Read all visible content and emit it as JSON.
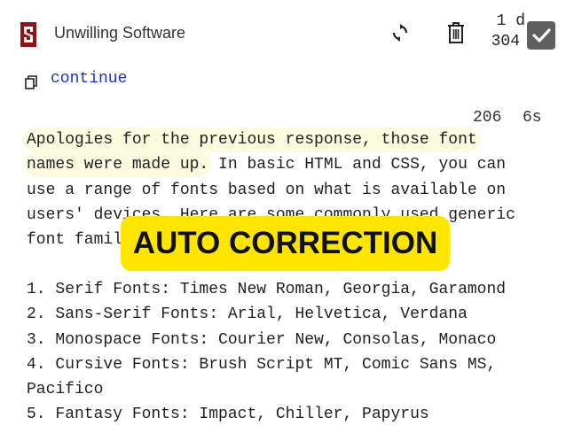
{
  "header": {
    "app_name": "Unwilling Software",
    "age": "1 d",
    "count": "304",
    "logo_icon": "stanford-s-logo",
    "brand_color": "#8c1515"
  },
  "actions": {
    "refresh_icon": "refresh-icon",
    "delete_icon": "trash-icon",
    "checkbox_checked": true
  },
  "prompt": {
    "continue_label": "continue",
    "copy_icon": "copy-icon"
  },
  "stats": {
    "tokens": "206",
    "time": "6s"
  },
  "response": {
    "highlight_line1": "Apologies for the previous response, those font",
    "highlight_line2": "names were made up.",
    "rest_line2": " In basic HTML and CSS, you can",
    "line3": "use a range of fonts based on what is available on",
    "line4": "users' devices. Here are some commonly used generic",
    "line5": "font families:",
    "list": [
      "1. Serif Fonts: Times New Roman, Georgia, Garamond",
      "2. Sans-Serif Fonts: Arial, Helvetica, Verdana",
      "3. Monospace Fonts: Courier New, Consolas, Monaco",
      "4. Cursive Fonts: Brush Script MT, Comic Sans MS,",
      "Pacifico",
      "5. Fantasy Fonts: Impact, Chiller, Papyrus"
    ]
  },
  "banner": {
    "text": "AUTO CORRECTION",
    "color": "#ffe600"
  }
}
